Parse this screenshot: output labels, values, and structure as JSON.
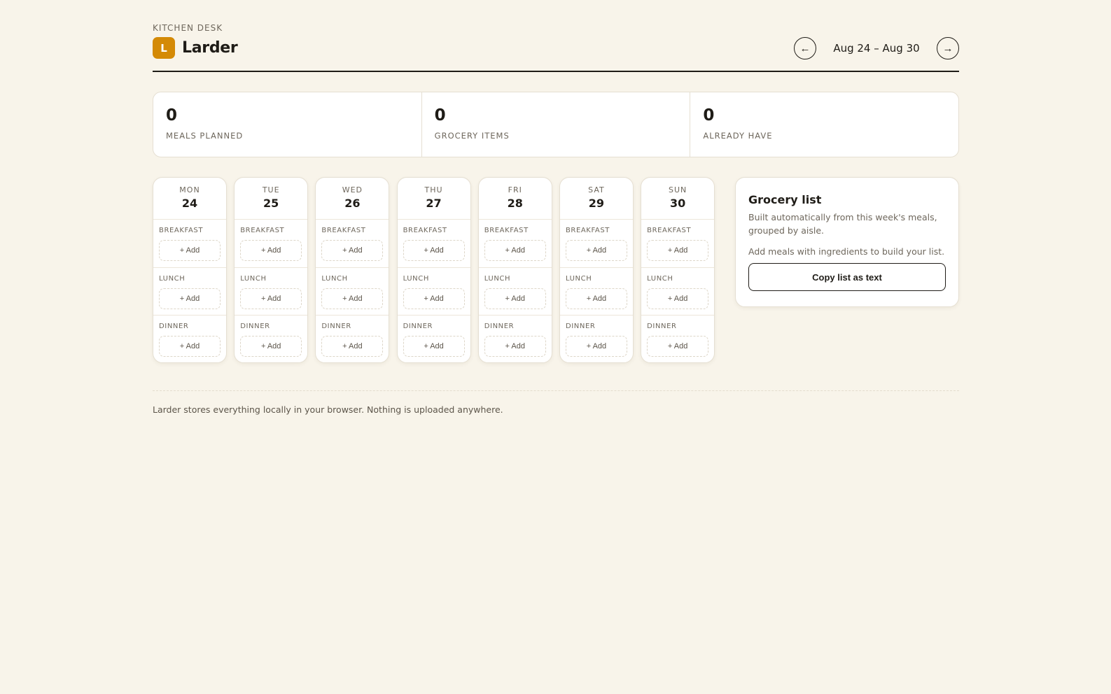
{
  "header": {
    "eyebrow": "KITCHEN DESK",
    "logo_letter": "L",
    "app_name": "Larder",
    "prev_label": "←",
    "week_range": "Aug 24 – Aug 30",
    "next_label": "→"
  },
  "stats": [
    {
      "value": "0",
      "label": "MEALS PLANNED"
    },
    {
      "value": "0",
      "label": "GROCERY ITEMS"
    },
    {
      "value": "0",
      "label": "ALREADY HAVE"
    }
  ],
  "days": [
    {
      "name": "MON",
      "num": "24"
    },
    {
      "name": "TUE",
      "num": "25"
    },
    {
      "name": "WED",
      "num": "26"
    },
    {
      "name": "THU",
      "num": "27"
    },
    {
      "name": "FRI",
      "num": "28"
    },
    {
      "name": "SAT",
      "num": "29"
    },
    {
      "name": "SUN",
      "num": "30"
    }
  ],
  "meal_slots": {
    "breakfast": "BREAKFAST",
    "lunch": "LUNCH",
    "dinner": "DINNER",
    "add_label": "+ Add"
  },
  "grocery": {
    "title": "Grocery list",
    "subtitle": "Built automatically from this week's meals, grouped by aisle.",
    "empty_text": "Add meals with ingredients to build your list.",
    "copy_label": "Copy list as text"
  },
  "footer": {
    "note": "Larder stores everything locally in your browser. Nothing is uploaded anywhere."
  },
  "colors": {
    "background": "#f8f4ea",
    "accent": "#d48a06",
    "text": "#1f1c17"
  }
}
